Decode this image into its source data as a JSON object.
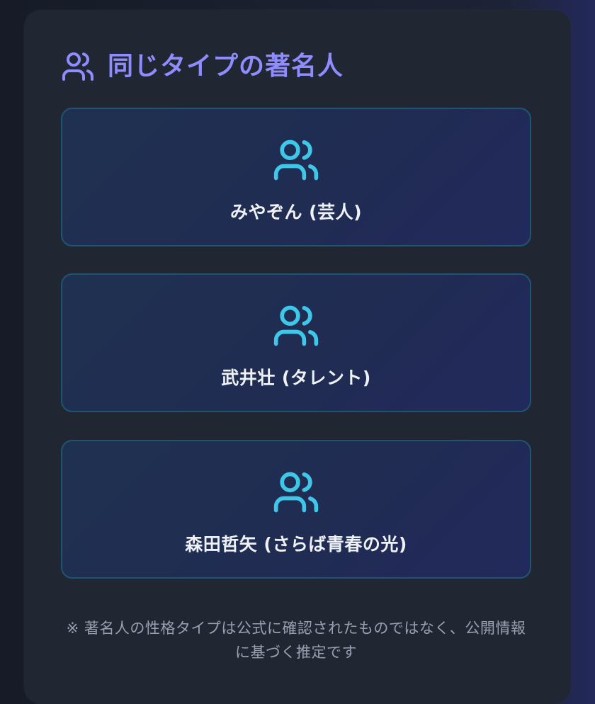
{
  "section": {
    "title": "同じタイプの著名人",
    "icon": "users-icon",
    "title_color": "#8f8cff"
  },
  "celebrities": [
    {
      "label": "みやぞん (芸人)",
      "icon": "users-icon"
    },
    {
      "label": "武井壮 (タレント)",
      "icon": "users-icon"
    },
    {
      "label": "森田哲矢 (さらば青春の光)",
      "icon": "users-icon"
    }
  ],
  "icon_color": "#3ec7e8",
  "disclaimer": "※ 著名人の性格タイプは公式に確認されたものではなく、公開情報に基づく推定です"
}
